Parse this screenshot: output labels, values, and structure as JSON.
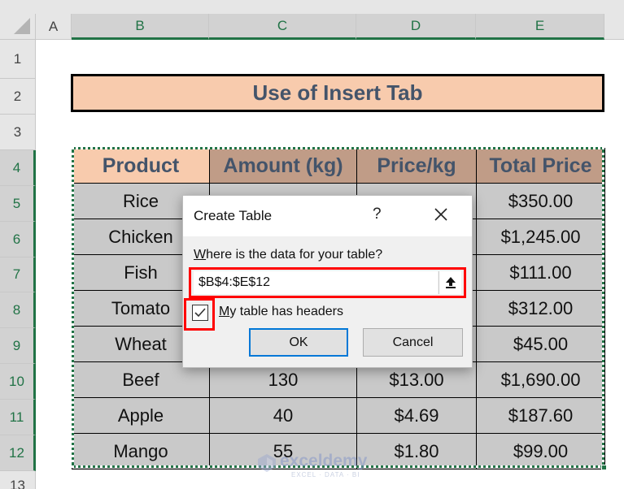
{
  "spreadsheet": {
    "columns": [
      "A",
      "B",
      "C",
      "D",
      "E"
    ],
    "rows": [
      "1",
      "2",
      "3",
      "4",
      "5",
      "6",
      "7",
      "8",
      "9",
      "10",
      "11",
      "12",
      "13"
    ],
    "selected_columns": [
      "B",
      "C",
      "D",
      "E"
    ],
    "selected_rows": [
      "4",
      "5",
      "6",
      "7",
      "8",
      "9",
      "10",
      "11",
      "12"
    ]
  },
  "title_cell": "Use of Insert Tab",
  "table": {
    "headers": [
      "Product",
      "Amount (kg)",
      "Price/kg",
      "Total Price"
    ],
    "rows": [
      [
        "Rice",
        "",
        "",
        "$350.00"
      ],
      [
        "Chicken",
        "",
        "",
        "$1,245.00"
      ],
      [
        "Fish",
        "",
        "",
        "$111.00"
      ],
      [
        "Tomato",
        "",
        "",
        "$312.00"
      ],
      [
        "Wheat",
        "",
        "",
        "$45.00"
      ],
      [
        "Beef",
        "130",
        "$13.00",
        "$1,690.00"
      ],
      [
        "Apple",
        "40",
        "$4.69",
        "$187.60"
      ],
      [
        "Mango",
        "55",
        "$1.80",
        "$99.00"
      ]
    ]
  },
  "dialog": {
    "title": "Create Table",
    "help_label": "?",
    "close_icon": "close-icon",
    "prompt_access_key": "W",
    "prompt_rest": "here is the data for your table?",
    "range_value": "$B$4:$E$12",
    "collapse_icon": "arrow-up-icon",
    "checkbox_checked": true,
    "checkbox_access_key": "M",
    "checkbox_label_rest": "y table has headers",
    "ok_label": "OK",
    "cancel_label": "Cancel"
  },
  "watermark": {
    "name": "exceldemy",
    "tagline": "EXCEL · DATA · BI"
  },
  "colors": {
    "excel_green": "#217346",
    "title_fill": "#f8cbad",
    "header_fill": "#c09c87",
    "cell_fill": "#c9c9c9",
    "highlight_red": "#ff0000",
    "ok_border": "#0078d7"
  }
}
